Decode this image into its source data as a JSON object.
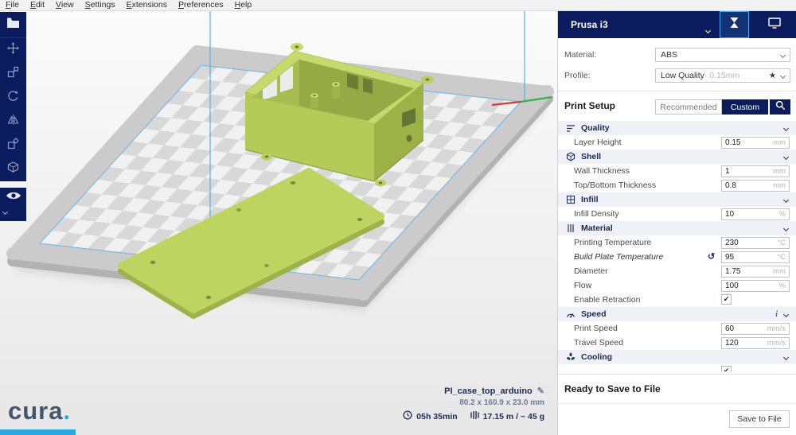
{
  "menu": {
    "items": [
      "File",
      "Edit",
      "View",
      "Settings",
      "Extensions",
      "Preferences",
      "Help"
    ]
  },
  "header": {
    "machine_name": "Prusa i3"
  },
  "sidebar": {
    "material_label": "Material:",
    "material_value": "ABS",
    "profile_label": "Profile:",
    "profile_value": "Low Quality",
    "profile_suffix": " - 0.15mm",
    "print_setup": {
      "title": "Print Setup",
      "recommended": "Recommended",
      "custom": "Custom"
    },
    "sections": [
      {
        "label": "Quality",
        "items": [
          {
            "label": "Layer Height",
            "value": "0.15",
            "unit": "mm"
          }
        ]
      },
      {
        "label": "Shell",
        "items": [
          {
            "label": "Wall Thickness",
            "value": "1",
            "unit": "mm"
          },
          {
            "label": "Top/Bottom Thickness",
            "value": "0.8",
            "unit": "mm"
          }
        ]
      },
      {
        "label": "Infill",
        "items": [
          {
            "label": "Infill Density",
            "value": "10",
            "unit": "%"
          }
        ]
      },
      {
        "label": "Material",
        "items": [
          {
            "label": "Printing Temperature",
            "value": "230",
            "unit": "°C"
          },
          {
            "label": "Build Plate Temperature",
            "value": "95",
            "unit": "°C",
            "modified": true
          },
          {
            "label": "Diameter",
            "value": "1.75",
            "unit": "mm"
          },
          {
            "label": "Flow",
            "value": "100",
            "unit": "%"
          },
          {
            "label": "Enable Retraction",
            "checkbox": true,
            "checked": true
          }
        ]
      },
      {
        "label": "Speed",
        "has_info": true,
        "items": [
          {
            "label": "Print Speed",
            "value": "60",
            "unit": "mm/s"
          },
          {
            "label": "Travel Speed",
            "value": "120",
            "unit": "mm/s"
          }
        ]
      },
      {
        "label": "Cooling",
        "items": []
      }
    ],
    "status_text": "Ready to Save to File",
    "save_button": "Save to File"
  },
  "job": {
    "name": "PI_case_top_arduino",
    "dimensions": "80.2 x 160.9 x 23.0 mm",
    "print_time": "05h 35min",
    "material_estimate": "17.15 m / ~ 45 g"
  },
  "brand": {
    "logo": "cura",
    "dot": "."
  },
  "icons": {
    "star": "★",
    "pencil": "✎",
    "reset": "↺",
    "check": "✔",
    "info": "i"
  },
  "colors": {
    "navy": "#0A1C5E",
    "accent_blue": "#3FA9F5",
    "model_green": "#B8CF57",
    "logo_dot": "#2DA9E1"
  }
}
